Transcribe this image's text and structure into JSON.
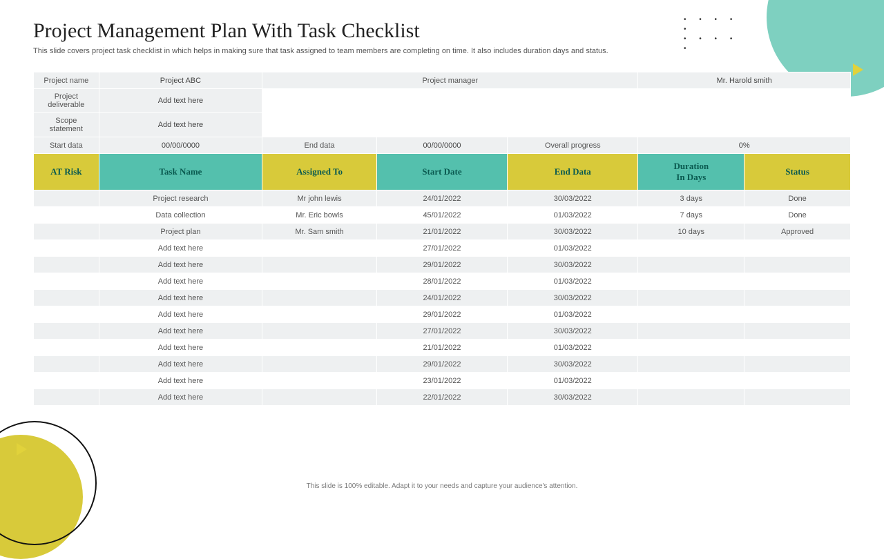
{
  "title": "Project Management Plan With Task Checklist",
  "subtitle": "This slide covers project task checklist in which helps in making sure that task assigned to team members are completing on time. It also includes duration days and status.",
  "meta": {
    "projectNameLabel": "Project name",
    "projectName": "Project ABC",
    "projectManagerLabel": "Project manager",
    "projectManager": "Mr. Harold smith",
    "deliverableLabel": "Project deliverable",
    "deliverable": "Add text here",
    "scopeLabel": "Scope statement",
    "scope": "Add text here",
    "startLabel": "Start data",
    "start": "00/00/0000",
    "endLabel": "End data",
    "end": "00/00/0000",
    "progressLabel": "Overall progress",
    "progress": "0%"
  },
  "columns": {
    "c0": "AT Risk",
    "c1": "Task Name",
    "c2": "Assigned To",
    "c3": "Start Date",
    "c4": "End Data",
    "c5": "Duration\nIn Days",
    "c6": "Status"
  },
  "tasks": [
    {
      "risk": "",
      "name": "Project research",
      "assigned": "Mr john lewis",
      "start": "24/01/2022",
      "end": "30/03/2022",
      "dur": "3  days",
      "status": "Done"
    },
    {
      "risk": "",
      "name": "Data collection",
      "assigned": "Mr. Eric bowls",
      "start": "45/01/2022",
      "end": "01/03/2022",
      "dur": "7 days",
      "status": "Done"
    },
    {
      "risk": "",
      "name": "Project plan",
      "assigned": "Mr. Sam smith",
      "start": "21/01/2022",
      "end": "30/03/2022",
      "dur": "10 days",
      "status": "Approved"
    },
    {
      "risk": "",
      "name": "Add text here",
      "assigned": "",
      "start": "27/01/2022",
      "end": "01/03/2022",
      "dur": "",
      "status": ""
    },
    {
      "risk": "",
      "name": "Add text here",
      "assigned": "",
      "start": "29/01/2022",
      "end": "30/03/2022",
      "dur": "",
      "status": ""
    },
    {
      "risk": "",
      "name": "Add text here",
      "assigned": "",
      "start": "28/01/2022",
      "end": "01/03/2022",
      "dur": "",
      "status": ""
    },
    {
      "risk": "",
      "name": "Add text here",
      "assigned": "",
      "start": "24/01/2022",
      "end": "30/03/2022",
      "dur": "",
      "status": ""
    },
    {
      "risk": "",
      "name": "Add text here",
      "assigned": "",
      "start": "29/01/2022",
      "end": "01/03/2022",
      "dur": "",
      "status": ""
    },
    {
      "risk": "",
      "name": "Add text here",
      "assigned": "",
      "start": "27/01/2022",
      "end": "30/03/2022",
      "dur": "",
      "status": ""
    },
    {
      "risk": "",
      "name": "Add text here",
      "assigned": "",
      "start": "21/01/2022",
      "end": "01/03/2022",
      "dur": "",
      "status": ""
    },
    {
      "risk": "",
      "name": "Add text here",
      "assigned": "",
      "start": "29/01/2022",
      "end": "30/03/2022",
      "dur": "",
      "status": ""
    },
    {
      "risk": "",
      "name": "Add text here",
      "assigned": "",
      "start": "23/01/2022",
      "end": "01/03/2022",
      "dur": "",
      "status": ""
    },
    {
      "risk": "",
      "name": "Add text here",
      "assigned": "",
      "start": "22/01/2022",
      "end": "30/03/2022",
      "dur": "",
      "status": ""
    }
  ],
  "footer": "This slide is 100% editable. Adapt it to your needs and capture your audience's attention."
}
